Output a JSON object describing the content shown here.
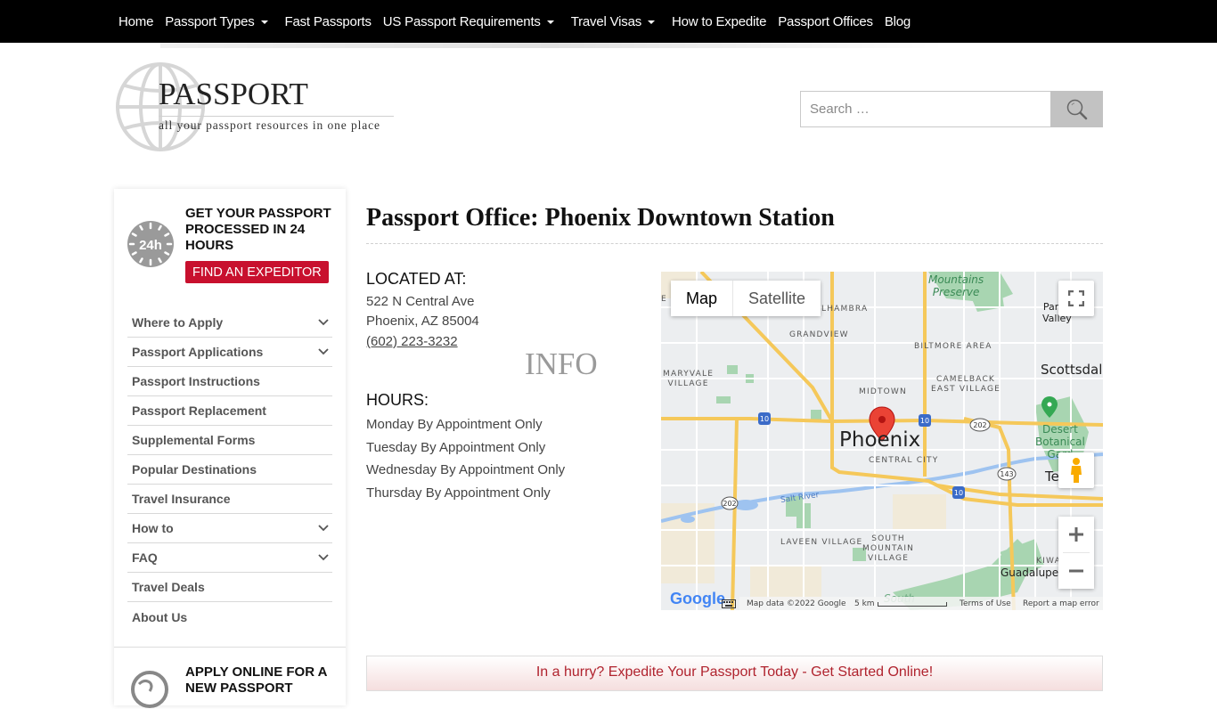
{
  "nav": {
    "items": [
      {
        "label": "Home",
        "dropdown": false
      },
      {
        "label": "Passport Types",
        "dropdown": true
      },
      {
        "label": "Fast Passports",
        "dropdown": false
      },
      {
        "label": "US Passport Requirements",
        "dropdown": true
      },
      {
        "label": "Travel Visas",
        "dropdown": true
      },
      {
        "label": "How to Expedite",
        "dropdown": false
      },
      {
        "label": "Passport Offices",
        "dropdown": false
      },
      {
        "label": "Blog",
        "dropdown": false
      }
    ]
  },
  "logo": {
    "brand_main": "PASSPORT",
    "brand_accent": "INFO",
    "tagline": "all your passport resources in one place"
  },
  "search": {
    "placeholder": "Search …",
    "value": "",
    "icon": "search-icon"
  },
  "sidebar": {
    "promo": {
      "icon": "24h-clock-icon",
      "icon_text": "24h",
      "title": "GET YOUR PASSPORT PROCESSED IN 24 HOURS",
      "button": "FIND AN EXPEDITOR"
    },
    "menu": [
      {
        "label": "Where to Apply",
        "expandable": true
      },
      {
        "label": "Passport Applications",
        "expandable": true
      },
      {
        "label": "Passport Instructions",
        "expandable": false
      },
      {
        "label": "Passport Replacement",
        "expandable": false
      },
      {
        "label": "Supplemental Forms",
        "expandable": false
      },
      {
        "label": "Popular Destinations",
        "expandable": false
      },
      {
        "label": "Travel Insurance",
        "expandable": false
      },
      {
        "label": "How to",
        "expandable": true
      },
      {
        "label": "FAQ",
        "expandable": true
      },
      {
        "label": "Travel Deals",
        "expandable": false
      },
      {
        "label": "About Us",
        "expandable": false
      }
    ],
    "promo2": {
      "icon": "globe-icon",
      "title": "APPLY ONLINE FOR A NEW PASSPORT"
    }
  },
  "main": {
    "title": "Passport Office: Phoenix Downtown Station",
    "located_label": "LOCATED AT:",
    "address_line1": "522 N Central Ave",
    "address_line2": "Phoenix, AZ 85004",
    "phone": "(602) 223-3232",
    "hours_label": "HOURS:",
    "hours": [
      "Monday By Appointment Only",
      "Tuesday By Appointment Only",
      "Wednesday By Appointment Only",
      "Thursday By Appointment Only"
    ]
  },
  "map": {
    "type_buttons": {
      "map": "Map",
      "satellite": "Satellite"
    },
    "active_type": "Map",
    "labels": {
      "city_main": "Phoenix",
      "alhambra": "LHAMBRA",
      "grandview": "GRANDVIEW",
      "maryvale": "MARYVALE\nVILLAGE",
      "midtown": "MIDTOWN",
      "biltmore": "BILTMORE AREA",
      "camelback": "CAMELBACK\nEAST VILLAGE",
      "central_city": "CENTRAL CITY",
      "laveen": "LAVEEN VILLAGE",
      "south_mountain": "SOUTH\nMOUNTAIN\nVILLAGE",
      "kiwanis": "KIWANI",
      "scottsdale": "Scottsdal",
      "paradise_valley": "Parad\nValley",
      "tempe": "Tem",
      "guadalupe": "Guadalupe",
      "mountains_preserve": "Mountains\nPreserve",
      "desert_botanical": "Desert\nBotanical\nGard",
      "salt_river": "Salt River",
      "south_park": "South",
      "e_edge": "E"
    },
    "shields": [
      "10",
      "10",
      "10",
      "202",
      "202",
      "143"
    ],
    "attribution": {
      "logo": "Google",
      "map_data": "Map data ©2022 Google",
      "scale": "5 km",
      "terms": "Terms of Use",
      "report": "Report a map error"
    }
  },
  "banner": {
    "text": "In a hurry? Expedite Your Passport Today - Get Started Online!"
  },
  "colors": {
    "nav_bg": "#000000",
    "accent_red": "#c8102e",
    "banner_text": "#b0232e",
    "search_button": "#c2c2c2"
  }
}
